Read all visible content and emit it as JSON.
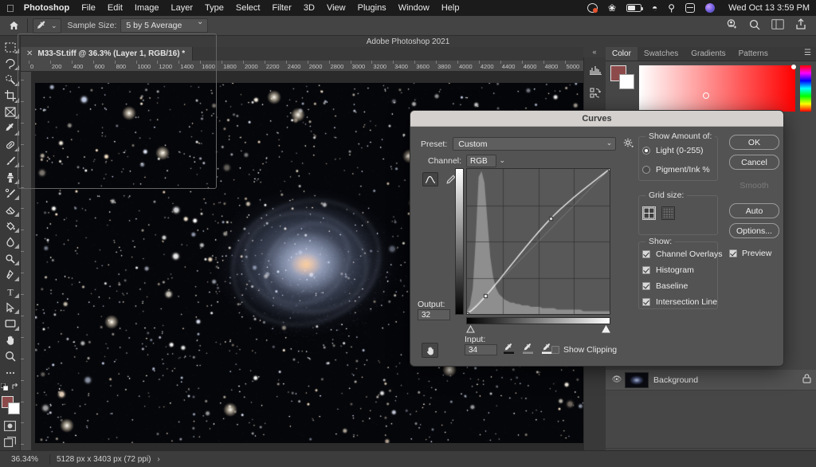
{
  "macbar": {
    "apple": "apple-logo",
    "menus": [
      "Photoshop",
      "File",
      "Edit",
      "Image",
      "Layer",
      "Type",
      "Select",
      "Filter",
      "3D",
      "View",
      "Plugins",
      "Window",
      "Help"
    ],
    "clock": "Wed Oct 13  3:59 PM",
    "status_icons": [
      "timemachine-icon",
      "bluetooth-icon",
      "battery-icon",
      "wifi-icon",
      "search-icon",
      "controlcenter-icon",
      "siri-icon"
    ]
  },
  "options_bar": {
    "home_icon": "home-icon",
    "tool_icon": "eyedropper-icon",
    "sample_size_label": "Sample Size:",
    "sample_size_value": "5 by 5 Average",
    "right_icons": [
      "share-user-icon",
      "search-icon",
      "arrange-icon",
      "export-icon"
    ]
  },
  "document": {
    "tab_title": "M33-St.tiff @ 36.3% (Layer 1, RGB/16) *",
    "close_icon": "close-icon",
    "window_title": "Adobe Photoshop 2021"
  },
  "rulers": {
    "h_ticks": [
      "0",
      "200",
      "400",
      "600",
      "800",
      "1000",
      "1200",
      "1400",
      "1600",
      "1800",
      "2000",
      "2200",
      "2400",
      "2600",
      "2800",
      "3000",
      "3200",
      "3400",
      "3600",
      "3800",
      "4000",
      "4200",
      "4400",
      "4600",
      "4800",
      "5000"
    ]
  },
  "toolbar": {
    "tools": [
      {
        "name": "marquee-tool",
        "icon": "marquee-icon"
      },
      {
        "name": "lasso-tool",
        "icon": "lasso-icon"
      },
      {
        "name": "object-selection-tool",
        "icon": "magicwand-icon"
      },
      {
        "name": "crop-tool",
        "icon": "crop-icon"
      },
      {
        "name": "frame-tool",
        "icon": "frame-icon"
      },
      {
        "name": "eyedropper-tool",
        "icon": "eyedropper-icon"
      },
      {
        "name": "healing-brush-tool",
        "icon": "bandaid-icon"
      },
      {
        "name": "brush-tool",
        "icon": "brush-icon"
      },
      {
        "name": "clone-stamp-tool",
        "icon": "stamp-icon"
      },
      {
        "name": "history-brush-tool",
        "icon": "historybrush-icon"
      },
      {
        "name": "eraser-tool",
        "icon": "eraser-icon"
      },
      {
        "name": "gradient-tool",
        "icon": "paintbucket-icon"
      },
      {
        "name": "blur-tool",
        "icon": "blur-icon"
      },
      {
        "name": "dodge-tool",
        "icon": "dodge-icon"
      },
      {
        "name": "pen-tool",
        "icon": "pen-icon"
      },
      {
        "name": "type-tool",
        "icon": "type-icon"
      },
      {
        "name": "path-selection-tool",
        "icon": "arrow-icon"
      },
      {
        "name": "rectangle-tool",
        "icon": "rectangle-icon"
      },
      {
        "name": "hand-tool",
        "icon": "hand-icon"
      },
      {
        "name": "zoom-tool",
        "icon": "zoom-icon"
      },
      {
        "name": "edit-toolbar",
        "icon": "ellipsis-icon"
      }
    ],
    "foreground_color": "#8d4a4a",
    "background_color": "#ffffff",
    "quickmask_icon": "quickmask-icon",
    "screenmode_icon": "screenmode-icon"
  },
  "color_panel": {
    "tabs": [
      "Color",
      "Swatches",
      "Gradients",
      "Patterns"
    ],
    "active_tab": "Color",
    "menu_icon": "panel-menu-icon"
  },
  "dock_icons": [
    "histogram-icon",
    "actions-icon",
    "play-icon"
  ],
  "layers_panel": {
    "layers": [
      {
        "name": "Background",
        "visible_icon": "eye-icon",
        "lock_icon": "lock-icon"
      }
    ],
    "footer_icons": [
      "link-icon",
      "fx-icon",
      "mask-icon",
      "adjustment-icon",
      "group-icon",
      "new-layer-icon",
      "delete-icon"
    ]
  },
  "status_bar": {
    "zoom": "36.34%",
    "doc_size": "5128 px x 3403 px (72 ppi)",
    "arrow_icon": "chevron-right-icon"
  },
  "curves_dialog": {
    "title": "Curves",
    "preset_label": "Preset:",
    "preset_value": "Custom",
    "preset_options_icon": "gear-icon",
    "channel_label": "Channel:",
    "channel_value": "RGB",
    "curve_tool_icon": "curve-point-icon",
    "pencil_tool_icon": "pencil-icon",
    "output_label": "Output:",
    "output_value": "32",
    "input_label": "Input:",
    "input_value": "34",
    "hand_tool_icon": "targeted-adjustment-icon",
    "eyedroppers": [
      "set-black-point-icon",
      "set-gray-point-icon",
      "set-white-point-icon"
    ],
    "show_clipping_label": "Show Clipping",
    "show_clipping_checked": false,
    "show_amount_of_label": "Show Amount of:",
    "amount_options": [
      {
        "label": "Light  (0-255)",
        "selected": true
      },
      {
        "label": "Pigment/Ink %",
        "selected": false
      }
    ],
    "grid_size_label": "Grid size:",
    "grid_options": [
      {
        "name": "grid-quarter-tone",
        "selected": true
      },
      {
        "name": "grid-ten-percent",
        "selected": false
      }
    ],
    "show_label": "Show:",
    "show_options": [
      {
        "label": "Channel Overlays",
        "checked": true
      },
      {
        "label": "Histogram",
        "checked": true
      },
      {
        "label": "Baseline",
        "checked": true
      },
      {
        "label": "Intersection Line",
        "checked": true
      }
    ],
    "buttons": [
      {
        "label": "OK",
        "enabled": true
      },
      {
        "label": "Cancel",
        "enabled": true
      },
      {
        "label": "Smooth",
        "enabled": false
      },
      {
        "label": "Auto",
        "enabled": true
      },
      {
        "label": "Options...",
        "enabled": true
      }
    ],
    "preview_label": "Preview",
    "preview_checked": true
  },
  "chart_data": {
    "type": "line",
    "title": "Curves",
    "xlabel": "Input",
    "ylabel": "Output",
    "xlim": [
      0,
      255
    ],
    "ylim": [
      0,
      255
    ],
    "grid": true,
    "control_points": [
      {
        "input": 0,
        "output": 0
      },
      {
        "input": 34,
        "output": 32
      },
      {
        "input": 150,
        "output": 168
      },
      {
        "input": 255,
        "output": 255
      }
    ],
    "series": [
      {
        "name": "RGB curve",
        "x": [
          0,
          34,
          80,
          150,
          200,
          255
        ],
        "y": [
          0,
          32,
          86,
          168,
          212,
          255
        ]
      }
    ],
    "histogram": {
      "description": "Dark-dominant astrophoto histogram: tall narrow spike near shadows with long low tail",
      "bins": [
        2,
        6,
        18,
        52,
        96,
        100,
        92,
        66,
        40,
        26,
        18,
        14,
        12,
        10,
        9,
        8,
        8,
        7,
        7,
        6,
        6,
        6,
        5,
        5,
        5,
        5,
        4,
        4,
        4,
        4,
        4,
        3,
        3,
        3,
        3,
        3,
        3,
        3,
        3,
        3,
        2,
        2,
        2,
        2,
        2,
        2,
        2,
        2,
        2,
        2
      ]
    }
  }
}
